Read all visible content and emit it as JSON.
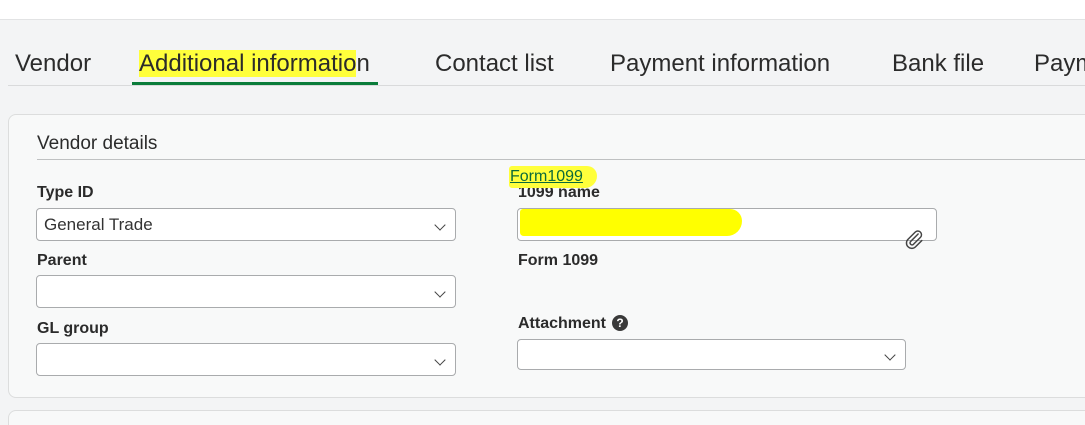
{
  "tabs": [
    {
      "label": "Vendor"
    },
    {
      "label_highlighted": "Additional informatio",
      "label_rest": "n"
    },
    {
      "label": "Contact list"
    },
    {
      "label": "Payment information"
    },
    {
      "label": "Bank file"
    },
    {
      "label": "Paym"
    }
  ],
  "active_tab": "Additional information",
  "section": {
    "title": "Vendor details"
  },
  "fields": {
    "type_id": {
      "label": "Type ID",
      "value": "General Trade"
    },
    "parent": {
      "label": "Parent",
      "value": ""
    },
    "gl_group": {
      "label": "GL group",
      "value": ""
    },
    "name_1099": {
      "label": "1099 name",
      "value": ""
    },
    "form_1099": {
      "label": "Form 1099",
      "link_text": "Form1099"
    },
    "attachment": {
      "label": "Attachment",
      "help_glyph": "?",
      "value": ""
    }
  },
  "icons": {
    "help": "help-circle-icon",
    "attach": "paperclip-icon",
    "dropdown": "chevron-down-icon"
  },
  "colors": {
    "accent": "#0a7c3a",
    "highlight": "#ffff00",
    "link": "#0b6a3a"
  }
}
